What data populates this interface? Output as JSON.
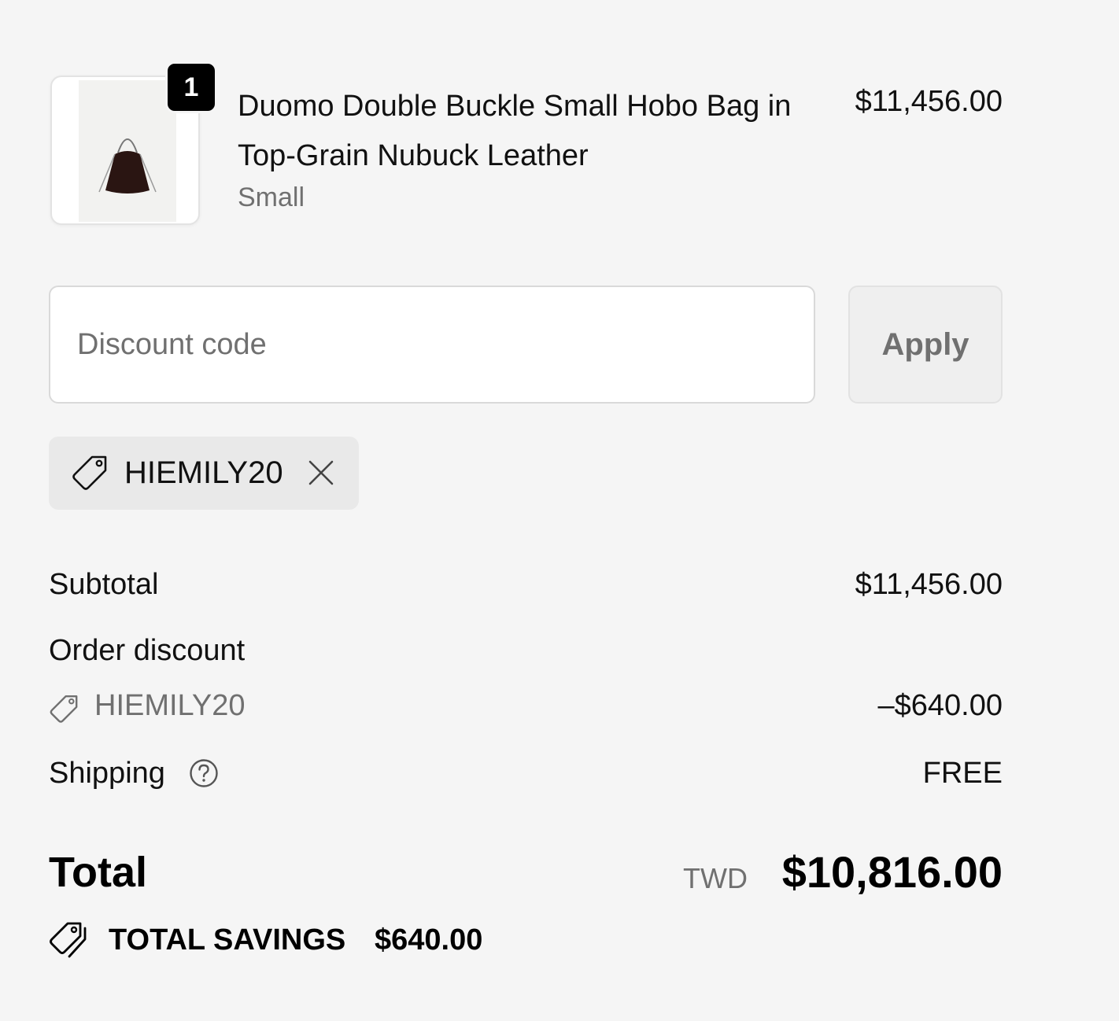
{
  "product": {
    "quantity": "1",
    "title": "Duomo Double Buckle Small Hobo Bag in Top-Grain Nubuck Leather",
    "variant": "Small",
    "price": "$11,456.00",
    "image_icon": "hobo-bag-image"
  },
  "discount": {
    "placeholder": "Discount code",
    "apply_label": "Apply",
    "applied_code": "HIEMILY20",
    "tag_icon": "tag-icon",
    "remove_icon": "close-icon"
  },
  "summary": {
    "subtotal_label": "Subtotal",
    "subtotal_value": "$11,456.00",
    "order_discount_label": "Order discount",
    "order_discount_code": "HIEMILY20",
    "order_discount_value": "–$640.00",
    "shipping_label": "Shipping",
    "shipping_value": "FREE",
    "help_icon": "question-circle-icon"
  },
  "total": {
    "label": "Total",
    "currency": "TWD",
    "value": "$10,816.00"
  },
  "savings": {
    "label": "TOTAL SAVINGS",
    "value": "$640.00",
    "icon": "tags-icon"
  },
  "colors": {
    "background": "#f5f5f5",
    "text": "#111111",
    "muted": "#707070",
    "badge": "#000000"
  }
}
